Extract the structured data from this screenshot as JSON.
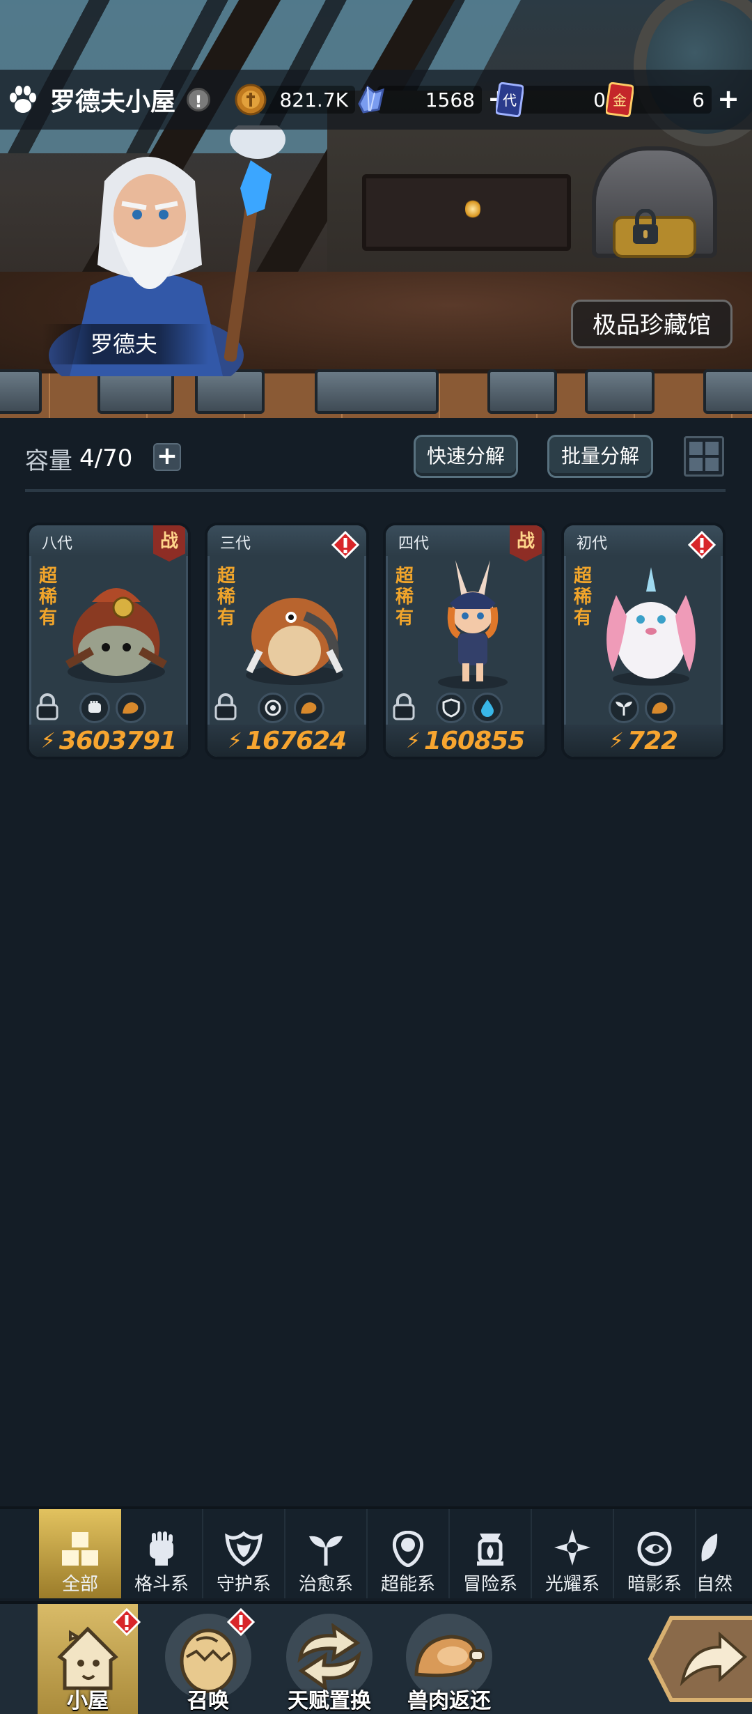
{
  "header": {
    "home_title": "罗德夫小屋",
    "info_badge": "!"
  },
  "resources": {
    "coins": "821.7K",
    "crystals": "1568",
    "generation_cards": "0",
    "gold_cards": "6",
    "generation_card_icon_text": "代",
    "gold_card_icon_text": "金"
  },
  "hero": {
    "npc_name": "罗德夫",
    "collection_button": "极品珍藏馆"
  },
  "toolbar": {
    "capacity_label": "容量",
    "capacity_value": "4/70",
    "quick_decompose": "快速分解",
    "batch_decompose": "批量分解"
  },
  "cards": [
    {
      "generation": "八代",
      "rarity": "超稀有",
      "tag": "战",
      "tag_type": "battle",
      "locked": true,
      "traits": [
        "fist-icon",
        "meat-icon"
      ],
      "power": "3603791"
    },
    {
      "generation": "三代",
      "rarity": "超稀有",
      "tag": "!",
      "tag_type": "alert",
      "locked": true,
      "traits": [
        "target-icon",
        "meat-icon"
      ],
      "power": "167624"
    },
    {
      "generation": "四代",
      "rarity": "超稀有",
      "tag": "战",
      "tag_type": "battle",
      "locked": true,
      "traits": [
        "shield-icon",
        "water-drop-icon"
      ],
      "power": "160855"
    },
    {
      "generation": "初代",
      "rarity": "超稀有",
      "tag": "!",
      "tag_type": "alert",
      "locked": false,
      "traits": [
        "sprout-icon",
        "meat-icon"
      ],
      "power": "722"
    }
  ],
  "filters": [
    {
      "label": "全部",
      "icon": "all-blocks-icon",
      "active": true
    },
    {
      "label": "格斗系",
      "icon": "fist-icon",
      "active": false
    },
    {
      "label": "守护系",
      "icon": "shield-icon",
      "active": false
    },
    {
      "label": "治愈系",
      "icon": "sprout-icon",
      "active": false
    },
    {
      "label": "超能系",
      "icon": "alien-icon",
      "active": false
    },
    {
      "label": "冒险系",
      "icon": "flame-icon",
      "active": false
    },
    {
      "label": "光耀系",
      "icon": "star-compass-icon",
      "active": false
    },
    {
      "label": "暗影系",
      "icon": "eye-icon",
      "active": false
    },
    {
      "label": "自然",
      "icon": "leaf-icon",
      "active": false
    }
  ],
  "nav": [
    {
      "label": "小屋",
      "icon": "house-icon",
      "active": true,
      "alert": true
    },
    {
      "label": "召唤",
      "icon": "egg-icon",
      "active": false,
      "alert": true
    },
    {
      "label": "天赋置换",
      "icon": "swap-arrows-icon",
      "active": false,
      "alert": false
    },
    {
      "label": "兽肉返还",
      "icon": "meat-icon",
      "active": false,
      "alert": false
    }
  ],
  "colors": {
    "background": "#141d26",
    "accent_gold": "#f7a530",
    "rarity_orange": "#f1a52b",
    "battle_red": "#8e2d25",
    "alert_red": "#d8262a"
  }
}
